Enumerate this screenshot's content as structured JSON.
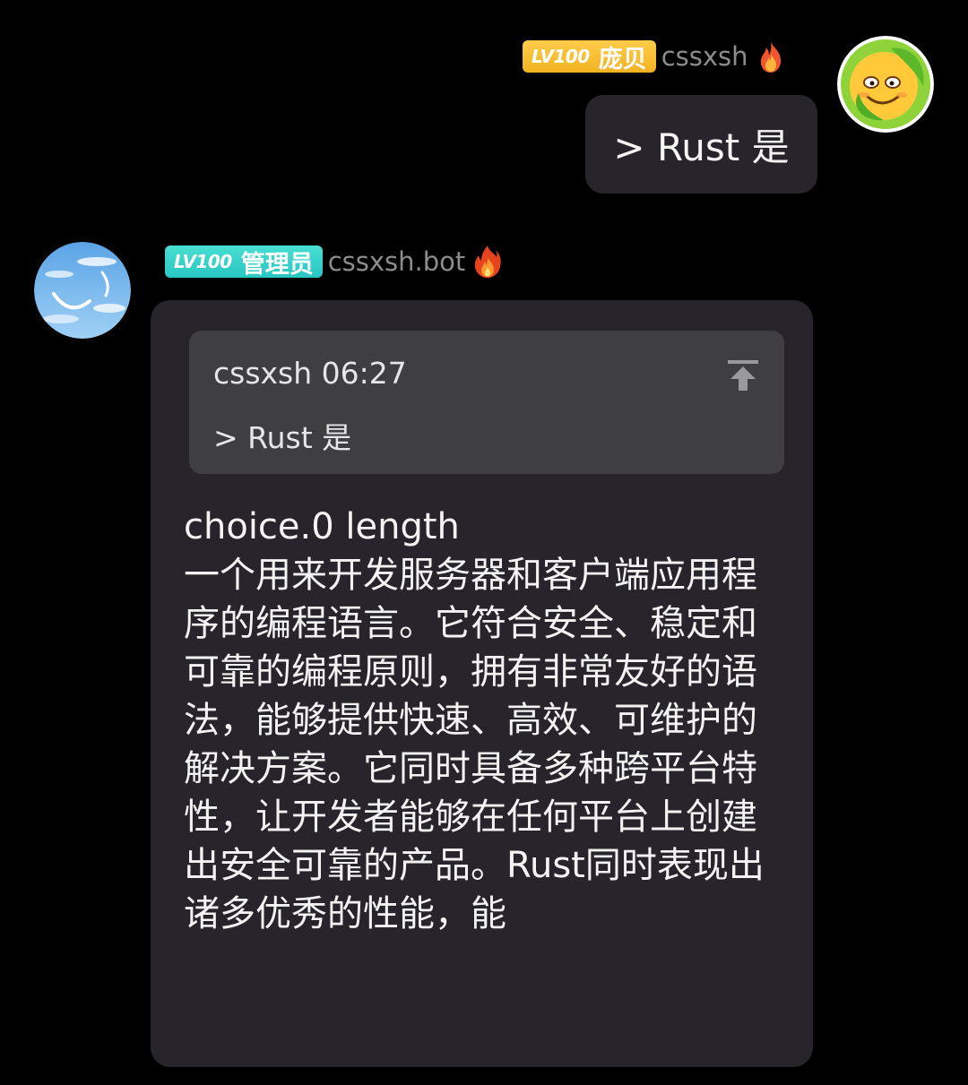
{
  "colors": {
    "background": "#000000",
    "bubble": "#27252b",
    "quote_box": "#3f3e43",
    "badge_gold": "#f2b322",
    "badge_teal": "#29c6c2",
    "username": "#8c8c8c"
  },
  "outgoing": {
    "sender": {
      "level": "LV100",
      "role": "庞贝",
      "name": "cssxsh",
      "avatar_icon": "cartoon-face-icon",
      "status_icon": "flame-icon"
    },
    "text": "> Rust 是"
  },
  "incoming": {
    "sender": {
      "level": "LV100",
      "role": "管理员",
      "name": "cssxsh.bot",
      "avatar_icon": "sky-smile-icon",
      "status_icon": "flame-icon"
    },
    "quote": {
      "meta": "cssxsh 06:27",
      "text": "> Rust 是",
      "jump_icon": "jump-to-top-icon"
    },
    "text": "choice.0 length\n一个用来开发服务器和客户端应用程序的编程语言。它符合安全、稳定和可靠的编程原则，拥有非常友好的语法，能够提供快速、高效、可维护的解决方案。它同时具备多种跨平台特性，让开发者能够在任何平台上创建出安全可靠的产品。Rust同时表现出诸多优秀的性能，能"
  }
}
